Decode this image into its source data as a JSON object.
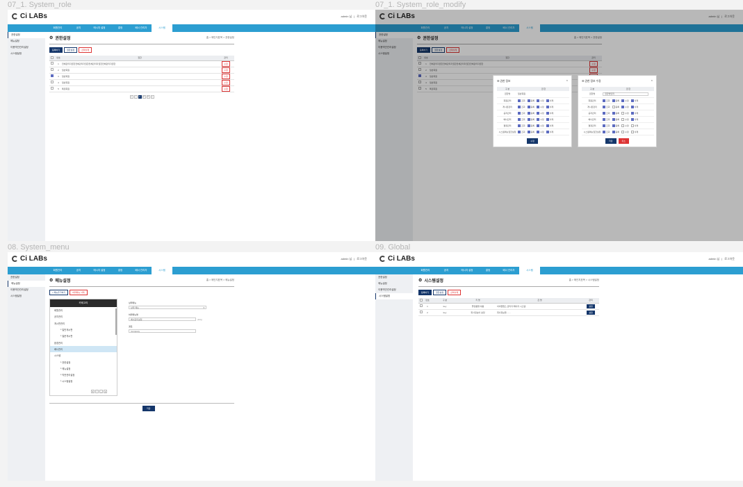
{
  "frames": {
    "role": {
      "label": "07_1. System_role"
    },
    "role_modify": {
      "label": "07_1. System_role_modify"
    },
    "menu": {
      "label": "08. System_menu"
    },
    "global": {
      "label": "09. Global"
    }
  },
  "common": {
    "logo": "Ci LABs",
    "user_name": "admin 님",
    "logout": "로그아웃",
    "nav": [
      "회원관리",
      "공지",
      "메시지 설정",
      "결정",
      "배너 관리자",
      "시스템"
    ],
    "sidebar": [
      "권한설정",
      "메뉴설정",
      "이용약관관리설정",
      "시스템설정"
    ]
  },
  "role": {
    "title": "권한설정",
    "crumb": "홈 > 메인지표목 > 권한설정",
    "buttons": {
      "add": "등록하기",
      "modify": "권한설정",
      "delete": "선택삭제"
    },
    "cols": {
      "no": "번호",
      "name": "권한",
      "manage": "관리"
    },
    "rows": [
      {
        "no": "1",
        "name": "전체관리자권한전체관리자권한전체관리자권한전체관리자권한",
        "checked": false
      },
      {
        "no": "2",
        "name": "일반회원",
        "checked": false
      },
      {
        "no": "3",
        "name": "일반회원",
        "checked": true
      },
      {
        "no": "4",
        "name": "일반회원",
        "checked": false
      },
      {
        "no": "5",
        "name": "특정회원",
        "checked": false
      }
    ],
    "row_button": "수정",
    "pages": [
      "«",
      "‹",
      "1",
      "2",
      "3",
      "»"
    ]
  },
  "modal_info": {
    "title": "권한 정보",
    "header": [
      "구 분",
      "권 한"
    ],
    "name_label": "권한명",
    "name_value": "일반회원",
    "perm_labels": [
      "조회",
      "등록",
      "수정",
      "삭제"
    ],
    "rows": [
      "회원관리",
      "게시판관리",
      "공지관리",
      "배너관리",
      "결정관리",
      "시스템메뉴권한설정"
    ],
    "close": "×",
    "btn": "수정"
  },
  "modal_edit": {
    "title": "권한 정보 수정",
    "header": [
      "구 분",
      "권 한"
    ],
    "name_label": "권한명",
    "name_value": "권한명입력",
    "rows": [
      "회원관리",
      "게시판관리",
      "공지관리",
      "배너관리",
      "결정관리",
      "시스템메뉴권한설정"
    ],
    "close": "×",
    "save": "저장",
    "cancel": "취소"
  },
  "menu": {
    "title": "메뉴설정",
    "crumb": "홈 > 메인지표목 > 메뉴설정",
    "add_btn": "+ 메뉴추가하기",
    "del_btn": "하위메뉴 삭제",
    "tree_head": "카테고리",
    "tree": [
      {
        "label": "회원관리",
        "sub": false,
        "sel": false
      },
      {
        "label": "공지관리",
        "sub": false,
        "sel": false
      },
      {
        "label": "게시판관리",
        "sub": false,
        "sel": false
      },
      {
        "label": "└ 일반게시판",
        "sub": true,
        "sel": false
      },
      {
        "label": "└ 질문게시판",
        "sub": true,
        "sel": false
      },
      {
        "label": "환경관리",
        "sub": false,
        "sel": false
      },
      {
        "label": "배너관리",
        "sub": false,
        "sel": true
      },
      {
        "label": "시스템",
        "sub": false,
        "sel": false
      },
      {
        "label": "└ 권한설정",
        "sub": true,
        "sel": false
      },
      {
        "label": "└ 메뉴설정",
        "sub": true,
        "sel": false
      },
      {
        "label": "└ 약관관리설정",
        "sub": true,
        "sel": false
      },
      {
        "label": "└ 시스템설정",
        "sub": true,
        "sel": false
      }
    ],
    "form": {
      "parent_label": "상위메뉴",
      "parent_value": "상위 메뉴",
      "name_label": "하위메뉴명",
      "name_value": "배너관리설정",
      "name_hint": "(10자)",
      "path_label": "경로",
      "path_value": "/company"
    },
    "save": "저장"
  },
  "global": {
    "title": "시스템설정",
    "crumb": "홈 > 메인지표목 > 시스템설정",
    "buttons": {
      "add": "등록하기",
      "modify": "권한설정",
      "delete": "선택삭제"
    },
    "cols": [
      "번호",
      "구 분",
      "키 명",
      "값 명",
      "관리"
    ],
    "rows": [
      {
        "no": "1",
        "type": "key",
        "key": "플랫폼명 이름",
        "value": "아이엠랩스 관리자 페이지 시스템"
      },
      {
        "no": "2",
        "type": "key",
        "key": "회사정보이 설정",
        "value": "회사정보들 ......"
      }
    ],
    "row_button": "설정"
  }
}
